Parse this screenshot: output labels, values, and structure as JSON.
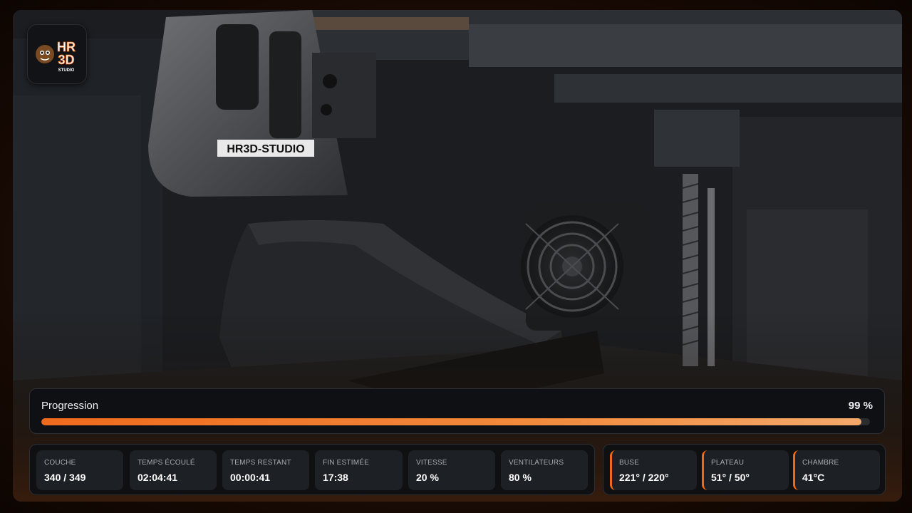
{
  "logo": {
    "text_top": "HR",
    "text_bottom": "3D",
    "sub": "STUDIO"
  },
  "camera": {
    "printhead_label": "HR3D-STUDIO"
  },
  "progress": {
    "label": "Progression",
    "value_text": "99 %",
    "percent": 99
  },
  "stats": [
    {
      "label": "COUCHE",
      "value": "340 / 349"
    },
    {
      "label": "TEMPS ÉCOULÉ",
      "value": "02:04:41"
    },
    {
      "label": "TEMPS RESTANT",
      "value": "00:00:41"
    },
    {
      "label": "FIN ESTIMÉE",
      "value": "17:38"
    },
    {
      "label": "VITESSE",
      "value": "20 %"
    },
    {
      "label": "VENTILATEURS",
      "value": "80 %"
    }
  ],
  "temps": [
    {
      "label": "BUSE",
      "value": "221° / 220°"
    },
    {
      "label": "PLATEAU",
      "value": "51° / 50°"
    },
    {
      "label": "CHAMBRE",
      "value": "41°C"
    }
  ],
  "colors": {
    "accent": "#f06a1c",
    "panel_bg": "#0e1013",
    "tile_bg": "#1d2024"
  }
}
